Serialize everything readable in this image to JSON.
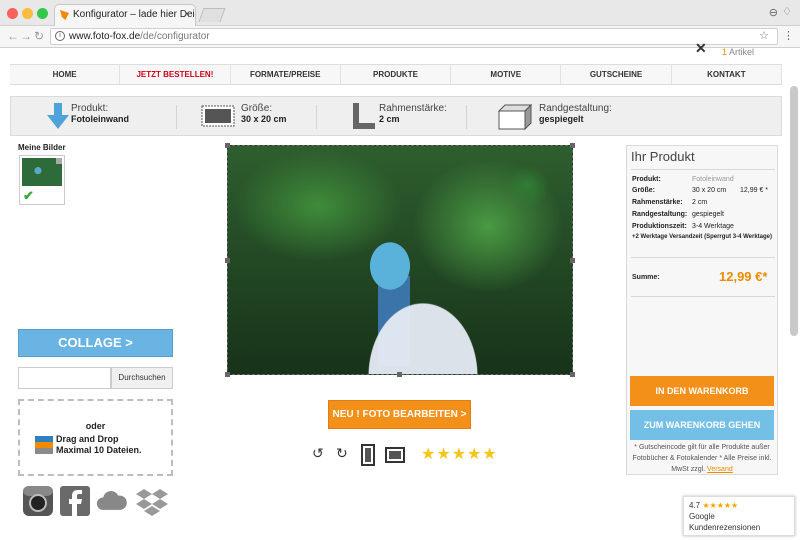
{
  "browser": {
    "tab_title": "Konfigurator – lade hier Dein",
    "url_host": "www.foto-fox.de",
    "url_path": "/de/configurator"
  },
  "header": {
    "cart_count": "1",
    "cart_label": "Artikel"
  },
  "nav": [
    "HOME",
    "JETZT BESTELLEN!",
    "FORMATE/PREISE",
    "PRODUKTE",
    "MOTIVE",
    "GUTSCHEINE",
    "KONTAKT"
  ],
  "config": {
    "produkt_label": "Produkt:",
    "produkt_value": "Fotoleinwand",
    "groesse_label": "Größe:",
    "groesse_value": "30 x 20 cm",
    "rahmen_label": "Rahmenstärke:",
    "rahmen_value": "2 cm",
    "rand_label": "Randgestaltung:",
    "rand_value": "gespiegelt"
  },
  "left": {
    "meine_bilder": "Meine Bilder",
    "collage": "COLLAGE  >",
    "search_button": "Durchsuchen",
    "dz_oder": "oder",
    "dz_drag": "Drag and Drop",
    "dz_max": "Maximal 10 Dateien."
  },
  "center": {
    "edit_button": "NEU ! FOTO BEARBEITEN  >",
    "rating_stars": 5
  },
  "right": {
    "title": "Ihr Produkt",
    "produkt_label": "Produkt:",
    "produkt_value": "Fotoleinwand",
    "groesse_label": "Größe:",
    "groesse_value": "30 x 20 cm",
    "groesse_price": "12,99 € *",
    "rahmen_label": "Rahmenstärke:",
    "rahmen_value": "2 cm",
    "rand_label": "Randgestaltung:",
    "rand_value": "gespiegelt",
    "prod_label": "Produktionszeit:",
    "prod_value": "3-4 Werktage",
    "prod_note": "+2 Werktage Versandzeit (Sperrgut 3-4 Werktage)",
    "summe_label": "Summe:",
    "summe_value": "12,99 €*",
    "cart_button": "IN DEN WARENKORB",
    "go_button": "ZUM WARENKORB GEHEN",
    "note1": "* Gutscheincode gilt für alle Produkte außer Fotobücher & Fotokalender * Alle Preise inkl. MwSt zzgl.",
    "note_link": "Versand"
  },
  "google": {
    "rating": "4.7",
    "stars": "★★★★★",
    "name": "Google",
    "label": "Kundenrezensionen"
  }
}
